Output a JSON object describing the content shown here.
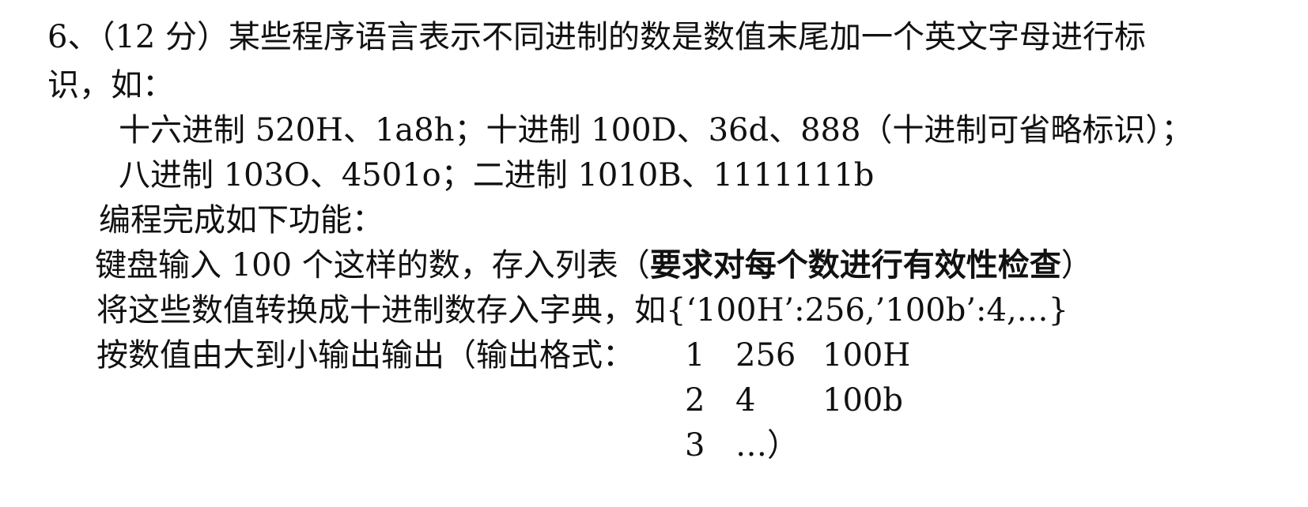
{
  "question": {
    "line1": "6、（12 分）某些程序语言表示不同进制的数是数值末尾加一个英文字母进行标",
    "line2": "识，如：",
    "line3": "十六进制 520H、1a8h；十进制 100D、36d、888（十进制可省略标识）；",
    "line4": "八进制 103O、4501o；二进制 1010B、1111111b",
    "line5": "编程完成如下功能：",
    "line6_prefix": "键盘输入 100 个这样的数，存入列表（",
    "line6_bold": "要求对每个数进行有效性检查",
    "line6_suffix": "）",
    "line7": "将这些数值转换成十进制数存入字典，如{‘100H’:256,’100b’:4,…}",
    "line8_prefix": "按数值由大到小输出输出（输出格式："
  },
  "output_example": {
    "rows": [
      {
        "index": "1",
        "value": "256",
        "source": "100H"
      },
      {
        "index": "2",
        "value": "4",
        "source": "100b"
      },
      {
        "index": "3",
        "value": "…）",
        "source": ""
      }
    ]
  }
}
